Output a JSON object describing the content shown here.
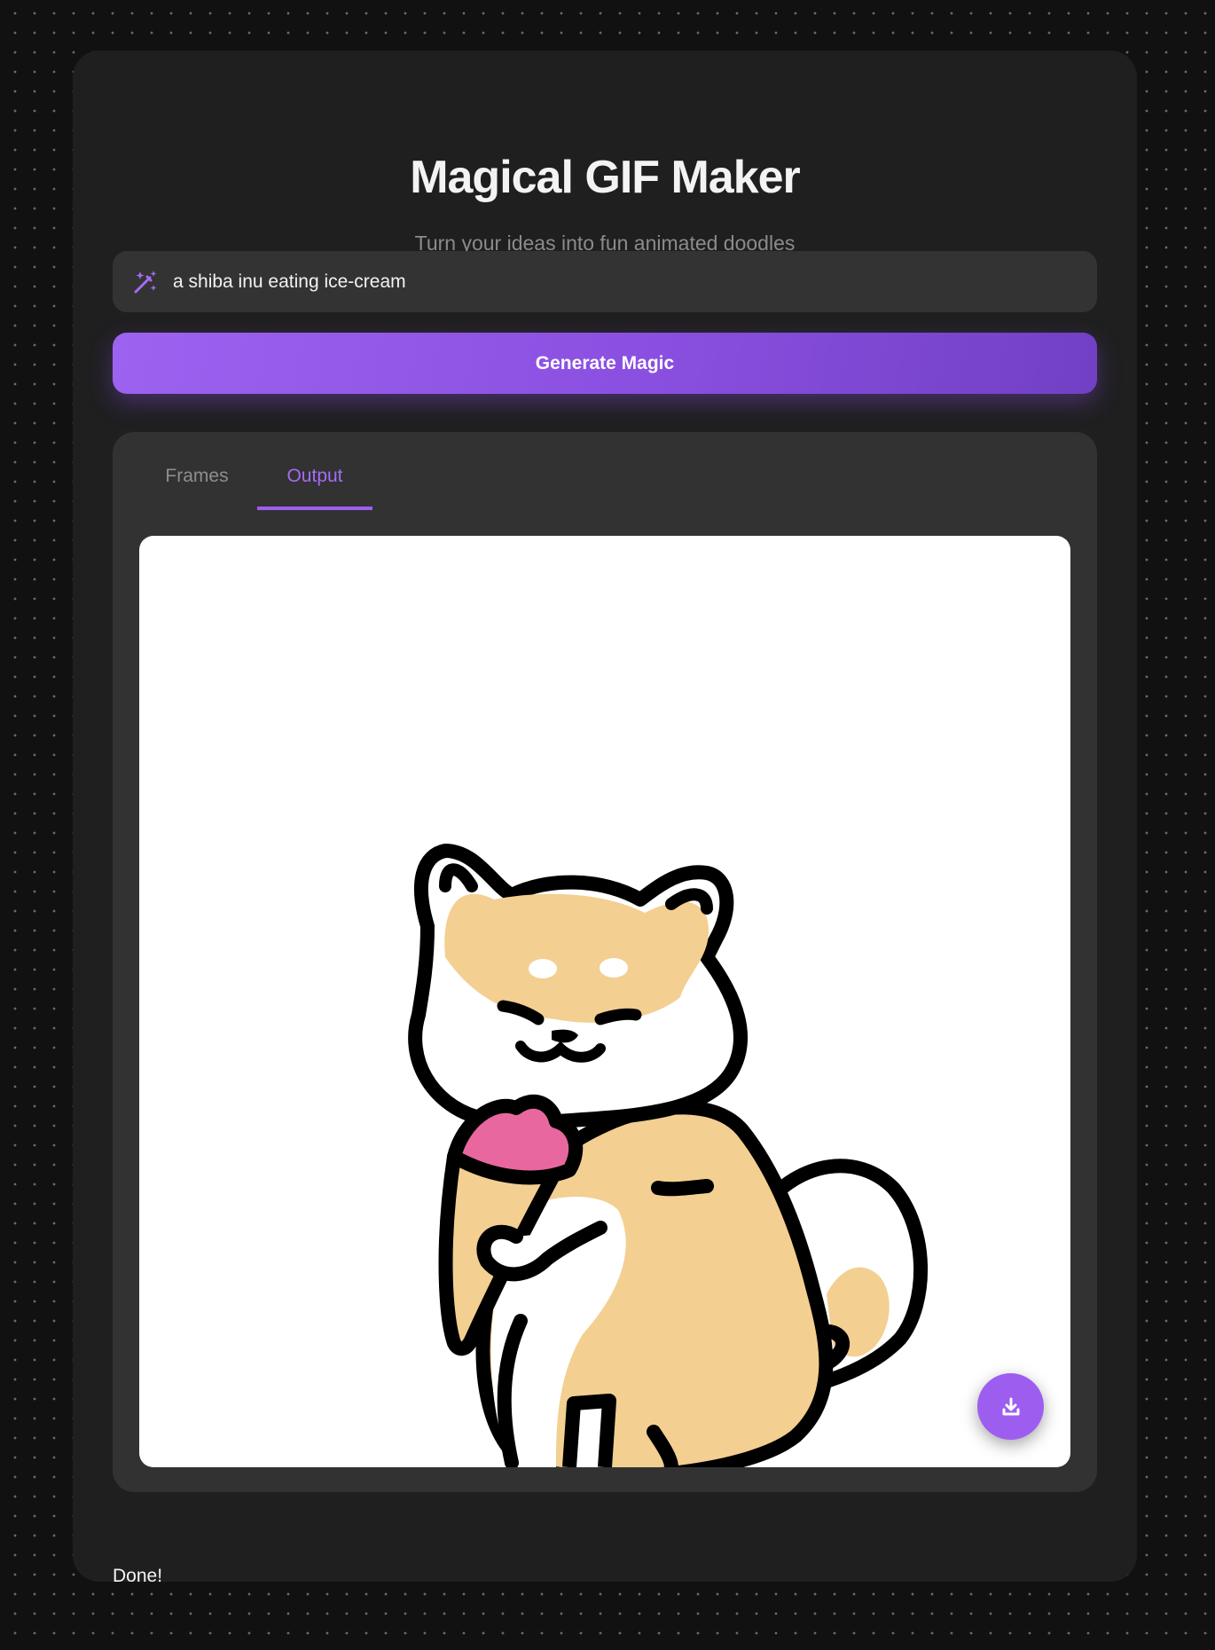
{
  "app": {
    "title": "Magical GIF Maker",
    "subtitle": "Turn your ideas into fun animated doodles"
  },
  "prompt": {
    "icon": "magic-wand-icon",
    "value": "a shiba inu eating ice-cream"
  },
  "generate_button": {
    "label": "Generate Magic"
  },
  "tabs": [
    {
      "label": "Frames",
      "active": false
    },
    {
      "label": "Output",
      "active": true
    }
  ],
  "output": {
    "image": "shiba inu eating ice-cream doodle",
    "download_icon": "download-icon"
  },
  "status": "Done!",
  "colors": {
    "accent": "#9d5ef0",
    "background": "#111112",
    "card": "#1f1f20",
    "panel": "#323233"
  }
}
